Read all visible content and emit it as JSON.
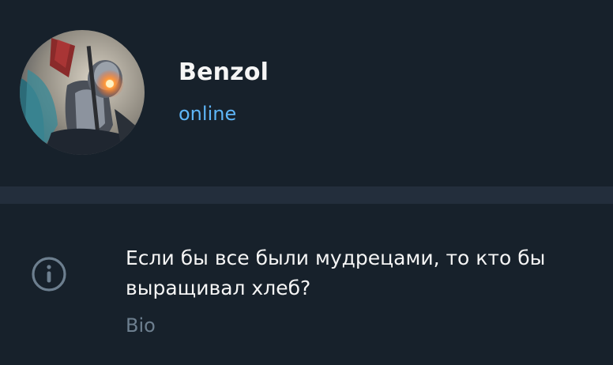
{
  "profile": {
    "name": "Benzol",
    "status": "online"
  },
  "bio": {
    "text": "Если бы все были мудрецами, то кто бы выращивал хлеб?",
    "label": "Bio"
  },
  "icons": {
    "info": "info-icon"
  },
  "colors": {
    "background": "#17212b",
    "separator": "#232e3c",
    "status_online": "#5eb5f7",
    "secondary_text": "#6d7f8f"
  }
}
